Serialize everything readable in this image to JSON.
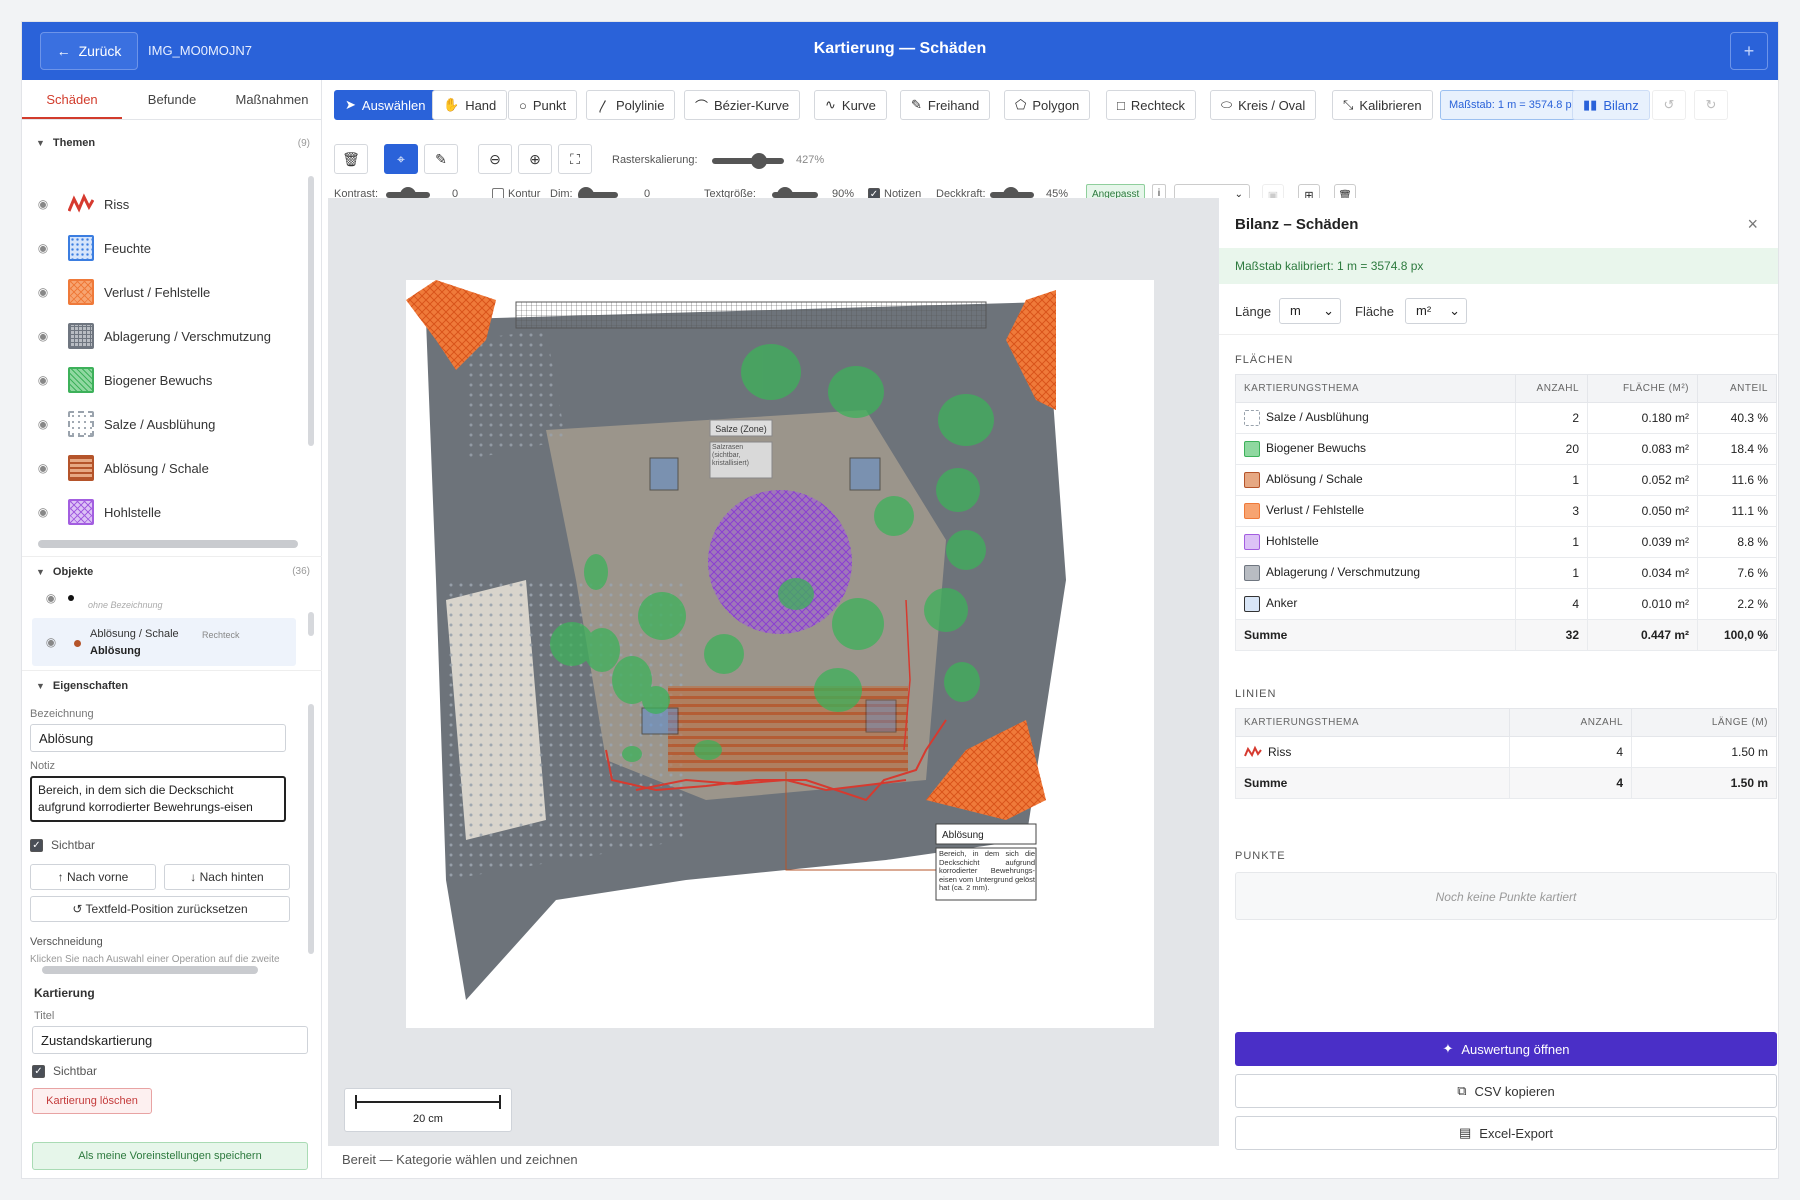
{
  "header": {
    "back_label": "Zurück",
    "image_name": "IMG_MO0MOJN7",
    "title": "Kartierung — Schäden"
  },
  "tabs": [
    {
      "label": "Schäden"
    },
    {
      "label": "Befunde"
    },
    {
      "label": "Maßnahmen"
    }
  ],
  "themes_section": {
    "title": "Themen",
    "count": "(9)"
  },
  "themes": [
    {
      "label": "Riss",
      "icon": "crack-zigzag-icon",
      "color": "#d63a2f"
    },
    {
      "label": "Feuchte",
      "icon": "dots-grid-icon",
      "color": "#3b7de0"
    },
    {
      "label": "Verlust / Fehlstelle",
      "icon": "crosshatch-icon",
      "color": "#ef7a3a"
    },
    {
      "label": "Ablagerung / Verschmutzung",
      "icon": "grid-icon",
      "color": "#6f7680"
    },
    {
      "label": "Biogener Bewuchs",
      "icon": "diagonal-hatch-icon",
      "color": "#3db15a"
    },
    {
      "label": "Salze / Ausblühung",
      "icon": "dotted-icon",
      "color": "#9aa3ad"
    },
    {
      "label": "Ablösung / Schale",
      "icon": "stripes-icon",
      "color": "#b5542a"
    },
    {
      "label": "Hohlstelle",
      "icon": "crosshatch-icon",
      "color": "#a35ee0"
    }
  ],
  "objects_section": {
    "title": "Objekte",
    "count": "(36)"
  },
  "objects": [
    {
      "name": "ohne Bezeichnung"
    },
    {
      "type": "Ablösung / Schale",
      "shape": "Rechteck",
      "name": "Ablösung"
    }
  ],
  "properties": {
    "title": "Eigenschaften",
    "name_label": "Bezeichnung",
    "name_value": "Ablösung",
    "note_label": "Notiz",
    "note_line1": "Bereich, in dem sich die Deckschicht",
    "note_line2": "aufgrund korrodierter Bewehrungs-eisen",
    "visible_label": "Sichtbar",
    "front_label": "↑ Nach vorne",
    "back_label": "↓ Nach hinten",
    "reset_label": "↺ Textfeld-Position zurücksetzen",
    "intersect_label": "Verschneidung",
    "intersect_hint": "Klicken Sie nach Auswahl einer Operation auf die zweite"
  },
  "mapping": {
    "title": "Kartierung",
    "title_label": "Titel",
    "title_value": "Zustandskartierung",
    "visible_label": "Sichtbar",
    "delete_label": "Kartierung löschen",
    "save_defaults_label": "Als meine Voreinstellungen speichern"
  },
  "tools": [
    {
      "label": "Auswählen",
      "icon": "cursor-icon"
    },
    {
      "label": "Hand",
      "icon": "hand-icon"
    },
    {
      "label": "Punkt",
      "icon": "circle-icon"
    },
    {
      "label": "Polylinie",
      "icon": "polyline-icon"
    },
    {
      "label": "Bézier-Kurve",
      "icon": "bezier-icon"
    },
    {
      "label": "Kurve",
      "icon": "curve-icon"
    },
    {
      "label": "Freihand",
      "icon": "freehand-icon"
    },
    {
      "label": "Polygon",
      "icon": "polygon-icon"
    },
    {
      "label": "Rechteck",
      "icon": "rectangle-icon"
    },
    {
      "label": "Kreis / Oval",
      "icon": "ellipse-icon"
    },
    {
      "label": "Kalibrieren",
      "icon": "calibrate-icon"
    }
  ],
  "scale_badge": "Maßstab: 1 m = 3574.8 px",
  "bilanz_label": "Bilanz",
  "grid_scale": {
    "label": "Rasterskalierung:",
    "value": "427%",
    "level": 0.7
  },
  "view": {
    "contrast_label": "Kontrast:",
    "contrast_value": "0",
    "contrast_level": 0.5,
    "contour_label": "Kontur",
    "dim_label": "Dim:",
    "dim_value": "0",
    "dim_level": 0.0,
    "textsize_label": "Textgröße:",
    "textsize_value": "90%",
    "textsize_level": 0.15,
    "notes_label": "Notizen",
    "opacity_label": "Deckkraft:",
    "opacity_value": "45%",
    "opacity_level": 0.45,
    "fit_badge": "Angepasst",
    "info": "i"
  },
  "canvas": {
    "label_salt": "Salze (Zone)",
    "label_salt_note": "Salzrasen (sichtbar, kristallisiert)",
    "callout_title": "Ablösung",
    "callout_text": "Bereich, in dem sich die Deckschicht aufgrund korrodierter Bewehrungs-eisen vom Untergrund gelöst hat (ca. 2 mm).",
    "scale_label": "20 cm"
  },
  "status": "Bereit — Kategorie wählen und zeichnen",
  "bilanz": {
    "title": "Bilanz – Schäden",
    "calibration": "Maßstab kalibriert: 1 m = 3574.8 px",
    "length_label": "Länge",
    "length_unit": "m",
    "area_label": "Fläche",
    "area_unit": "m²",
    "areas_caption": "FLÄCHEN",
    "areas_headers": [
      "KARTIERUNGSTHEMA",
      "ANZAHL",
      "FLÄCHE (M²)",
      "ANTEIL"
    ],
    "areas": [
      {
        "theme": "Salze / Ausblühung",
        "color": "#9aa3ad",
        "count": "2",
        "area": "0.180 m²",
        "share": "40.3 %"
      },
      {
        "theme": "Biogener Bewuchs",
        "color": "#3db15a",
        "count": "20",
        "area": "0.083 m²",
        "share": "18.4 %"
      },
      {
        "theme": "Ablösung / Schale",
        "color": "#b5542a",
        "count": "1",
        "area": "0.052 m²",
        "share": "11.6 %"
      },
      {
        "theme": "Verlust / Fehlstelle",
        "color": "#ef7a3a",
        "count": "3",
        "area": "0.050 m²",
        "share": "11.1 %"
      },
      {
        "theme": "Hohlstelle",
        "color": "#a35ee0",
        "count": "1",
        "area": "0.039 m²",
        "share": "8.8 %"
      },
      {
        "theme": "Ablagerung / Verschmutzung",
        "color": "#6f7680",
        "count": "1",
        "area": "0.034 m²",
        "share": "7.6 %"
      },
      {
        "theme": "Anker",
        "color": "#5b8fd6",
        "count": "4",
        "area": "0.010 m²",
        "share": "2.2 %"
      }
    ],
    "areas_sum": {
      "label": "Summe",
      "count": "32",
      "area": "0.447 m²",
      "share": "100,0 %"
    },
    "lines_caption": "LINIEN",
    "lines_headers": [
      "KARTIERUNGSTHEMA",
      "ANZAHL",
      "LÄNGE (M)"
    ],
    "lines": [
      {
        "theme": "Riss",
        "count": "4",
        "length": "1.50 m"
      }
    ],
    "lines_sum": {
      "label": "Summe",
      "count": "4",
      "length": "1.50 m"
    },
    "points_caption": "PUNKTE",
    "points_empty": "Noch keine Punkte kartiert",
    "open_eval": "Auswertung öffnen",
    "copy_csv": "CSV kopieren",
    "excel_export": "Excel-Export"
  }
}
